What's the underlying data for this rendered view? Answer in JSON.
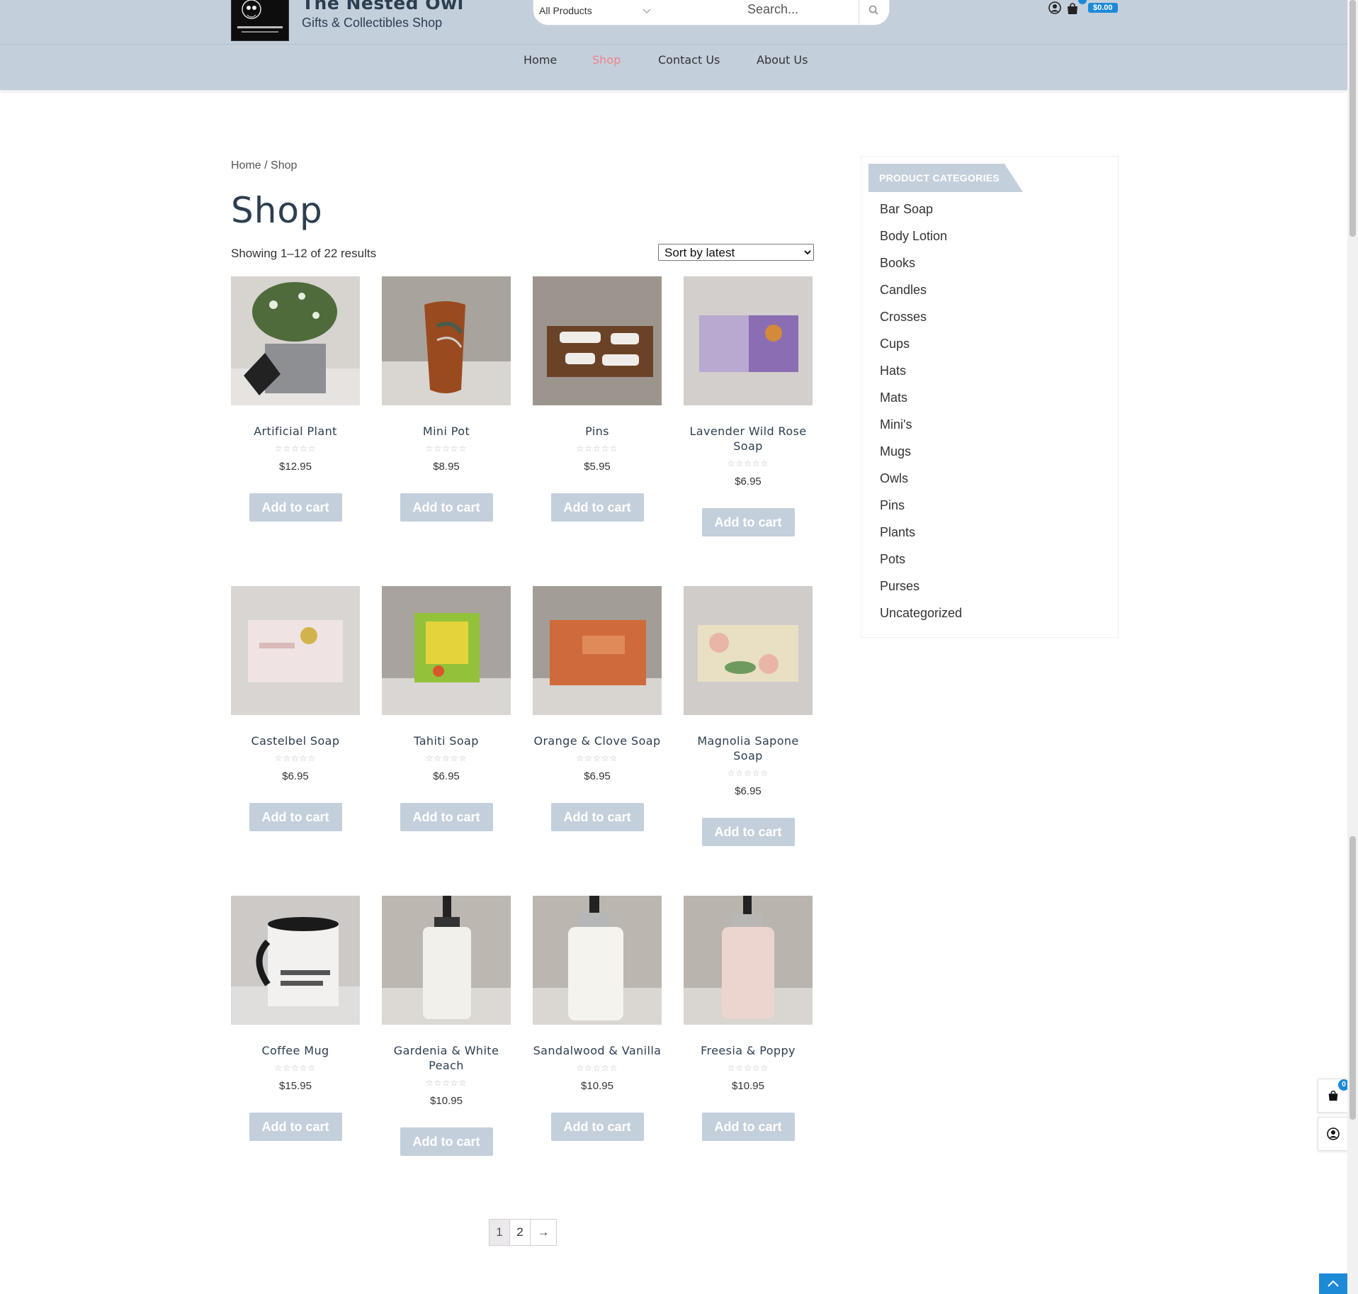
{
  "header": {
    "site_title": "The Nested Owl",
    "tagline": "Gifts & Collectibles Shop",
    "search": {
      "category": "All Products",
      "placeholder": "Search..."
    },
    "cart_total": "$0.00"
  },
  "nav": [
    {
      "label": "Home",
      "active": false
    },
    {
      "label": "Shop",
      "active": true
    },
    {
      "label": "Contact Us",
      "active": false
    },
    {
      "label": "About Us",
      "active": false
    }
  ],
  "breadcrumb": "Home / Shop",
  "page_title": "Shop",
  "results_count": "Showing 1–12 of 22 results",
  "sort": {
    "selected": "Sort by latest"
  },
  "products": [
    {
      "title": "Artificial Plant",
      "price": "$12.95",
      "button": "Add to cart",
      "icon": "plant-photo"
    },
    {
      "title": "Mini Pot",
      "price": "$8.95",
      "button": "Add to cart",
      "icon": "mini-pot-photo"
    },
    {
      "title": "Pins",
      "price": "$5.95",
      "button": "Add to cart",
      "icon": "pins-photo"
    },
    {
      "title": "Lavender Wild Rose Soap",
      "price": "$6.95",
      "button": "Add to cart",
      "icon": "soap-photo"
    },
    {
      "title": "Castelbel Soap",
      "price": "$6.95",
      "button": "Add to cart",
      "icon": "soap-photo"
    },
    {
      "title": "Tahiti Soap",
      "price": "$6.95",
      "button": "Add to cart",
      "icon": "soap-photo"
    },
    {
      "title": "Orange & Clove Soap",
      "price": "$6.95",
      "button": "Add to cart",
      "icon": "soap-photo"
    },
    {
      "title": "Magnolia Sapone Soap",
      "price": "$6.95",
      "button": "Add to cart",
      "icon": "soap-photo"
    },
    {
      "title": "Coffee Mug",
      "price": "$15.95",
      "button": "Add to cart",
      "icon": "mug-photo"
    },
    {
      "title": "Gardenia & White Peach",
      "price": "$10.95",
      "button": "Add to cart",
      "icon": "lotion-photo"
    },
    {
      "title": "Sandalwood & Vanilla",
      "price": "$10.95",
      "button": "Add to cart",
      "icon": "lotion-photo"
    },
    {
      "title": "Freesia & Poppy",
      "price": "$10.95",
      "button": "Add to cart",
      "icon": "lotion-photo"
    }
  ],
  "sidebar": {
    "heading": "PRODUCT CATEGORIES",
    "categories": [
      "Bar Soap",
      "Body Lotion",
      "Books",
      "Candles",
      "Crosses",
      "Cups",
      "Hats",
      "Mats",
      "Mini's",
      "Mugs",
      "Owls",
      "Pins",
      "Plants",
      "Pots",
      "Purses",
      "Uncategorized"
    ]
  },
  "pagination": {
    "pages": [
      "1",
      "2"
    ],
    "current": "1",
    "next": "→"
  },
  "floating_cart_count": "0",
  "colors": {
    "header_bg": "#c4cfdc",
    "accent": "#1d8ad8",
    "active_nav": "#f0848a",
    "title": "#2d3e50"
  }
}
